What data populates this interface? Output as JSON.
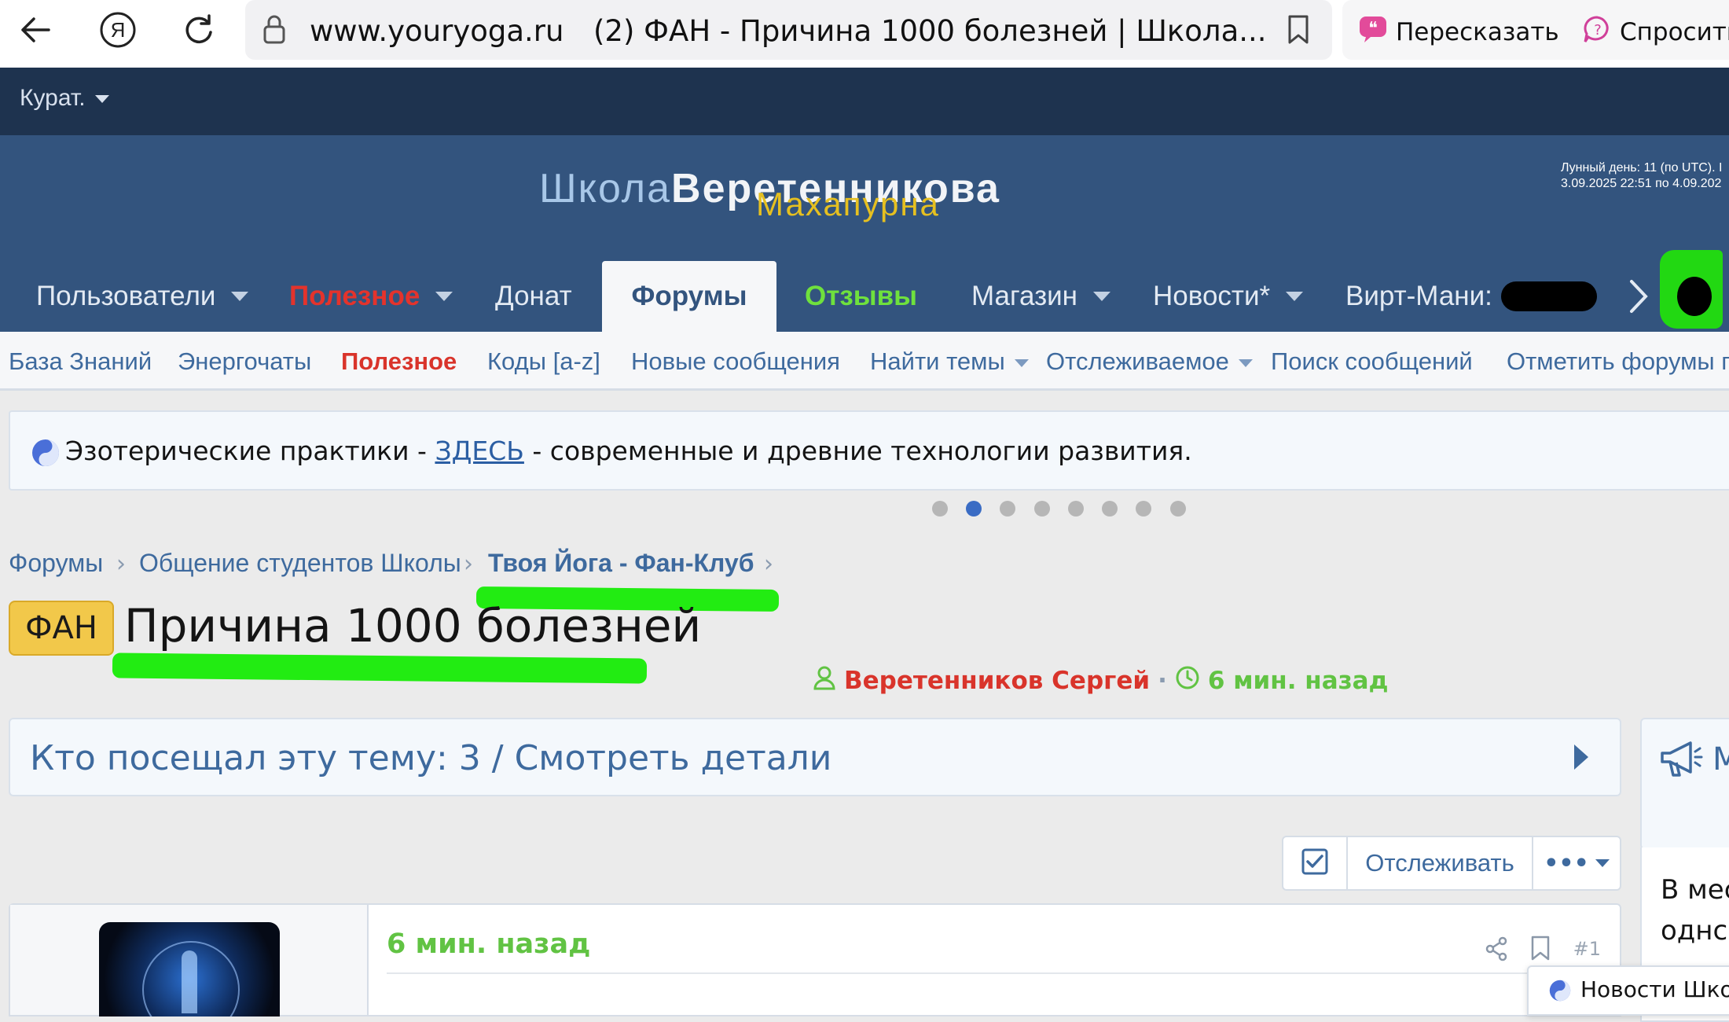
{
  "browser": {
    "url": "www.youryoga.ru",
    "tab_title": "(2) ФАН - Причина 1000 болезней | Школа...",
    "retell_label": "Пересказать",
    "ask_label": "Спросить"
  },
  "topbar": {
    "curator_label": "Курат."
  },
  "header": {
    "logo_part1": "Школа",
    "logo_part2": "Веретенникова",
    "logo_sub": "Махапурна",
    "lunar_line1": "Лунный день: 11 (по UTC). I",
    "lunar_line2": "3.09.2025 22:51 по 4.09.202"
  },
  "nav": {
    "users": "Пользователи",
    "useful": "Полезное",
    "donate": "Донат",
    "forums": "Форумы",
    "reviews": "Отзывы",
    "shop": "Магазин",
    "news": "Новости*",
    "virt_money": "Вирт-Мани:"
  },
  "subnav": {
    "items": [
      "База Знаний",
      "Энергочаты",
      "Полезное",
      "Коды [a-z]",
      "Новые сообщения",
      "Найти темы",
      "Отслеживаемое",
      "Поиск сообщений",
      "Отметить форумы п"
    ]
  },
  "notice": {
    "before": "Эзотерические практики - ",
    "link": "ЗДЕСЬ",
    "after": " - современные и древние технологии развития.",
    "active_slide": 2,
    "slides": 8
  },
  "breadcrumb": {
    "items": [
      "Форумы",
      "Общение студентов Школы",
      "Твоя Йога - Фан-Клуб"
    ]
  },
  "thread": {
    "prefix": "ФАН",
    "title": "Причина 1000 болезней",
    "author": "Веретенников Сергей",
    "time": "6 мин. назад"
  },
  "visitors": {
    "text": "Кто посещал эту тему: 3 / Смотреть детали"
  },
  "sidebar": {
    "header_partial": "М",
    "text_line1": "В мес",
    "text_line2": "однс"
  },
  "actions": {
    "watch_label": "Отслеживать",
    "more_label": "•••"
  },
  "post": {
    "time": "6 мин. назад",
    "number": "#1"
  },
  "toast": {
    "text": "Новости Школы"
  },
  "colors": {
    "header_bg": "#33547e",
    "topbar_bg": "#1e334f",
    "link": "#3e6a9e",
    "red": "#d9342b",
    "green": "#61c343",
    "highlight": "#22ec12"
  }
}
